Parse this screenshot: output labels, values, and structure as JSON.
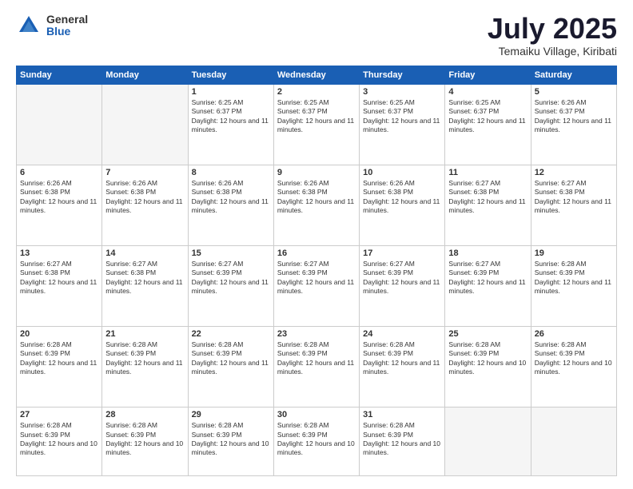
{
  "logo": {
    "general": "General",
    "blue": "Blue"
  },
  "header": {
    "month_year": "July 2025",
    "location": "Temaiku Village, Kiribati"
  },
  "days_of_week": [
    "Sunday",
    "Monday",
    "Tuesday",
    "Wednesday",
    "Thursday",
    "Friday",
    "Saturday"
  ],
  "weeks": [
    [
      {
        "day": "",
        "info": ""
      },
      {
        "day": "",
        "info": ""
      },
      {
        "day": "1",
        "info": "Sunrise: 6:25 AM\nSunset: 6:37 PM\nDaylight: 12 hours and 11 minutes."
      },
      {
        "day": "2",
        "info": "Sunrise: 6:25 AM\nSunset: 6:37 PM\nDaylight: 12 hours and 11 minutes."
      },
      {
        "day": "3",
        "info": "Sunrise: 6:25 AM\nSunset: 6:37 PM\nDaylight: 12 hours and 11 minutes."
      },
      {
        "day": "4",
        "info": "Sunrise: 6:25 AM\nSunset: 6:37 PM\nDaylight: 12 hours and 11 minutes."
      },
      {
        "day": "5",
        "info": "Sunrise: 6:26 AM\nSunset: 6:37 PM\nDaylight: 12 hours and 11 minutes."
      }
    ],
    [
      {
        "day": "6",
        "info": "Sunrise: 6:26 AM\nSunset: 6:38 PM\nDaylight: 12 hours and 11 minutes."
      },
      {
        "day": "7",
        "info": "Sunrise: 6:26 AM\nSunset: 6:38 PM\nDaylight: 12 hours and 11 minutes."
      },
      {
        "day": "8",
        "info": "Sunrise: 6:26 AM\nSunset: 6:38 PM\nDaylight: 12 hours and 11 minutes."
      },
      {
        "day": "9",
        "info": "Sunrise: 6:26 AM\nSunset: 6:38 PM\nDaylight: 12 hours and 11 minutes."
      },
      {
        "day": "10",
        "info": "Sunrise: 6:26 AM\nSunset: 6:38 PM\nDaylight: 12 hours and 11 minutes."
      },
      {
        "day": "11",
        "info": "Sunrise: 6:27 AM\nSunset: 6:38 PM\nDaylight: 12 hours and 11 minutes."
      },
      {
        "day": "12",
        "info": "Sunrise: 6:27 AM\nSunset: 6:38 PM\nDaylight: 12 hours and 11 minutes."
      }
    ],
    [
      {
        "day": "13",
        "info": "Sunrise: 6:27 AM\nSunset: 6:38 PM\nDaylight: 12 hours and 11 minutes."
      },
      {
        "day": "14",
        "info": "Sunrise: 6:27 AM\nSunset: 6:38 PM\nDaylight: 12 hours and 11 minutes."
      },
      {
        "day": "15",
        "info": "Sunrise: 6:27 AM\nSunset: 6:39 PM\nDaylight: 12 hours and 11 minutes."
      },
      {
        "day": "16",
        "info": "Sunrise: 6:27 AM\nSunset: 6:39 PM\nDaylight: 12 hours and 11 minutes."
      },
      {
        "day": "17",
        "info": "Sunrise: 6:27 AM\nSunset: 6:39 PM\nDaylight: 12 hours and 11 minutes."
      },
      {
        "day": "18",
        "info": "Sunrise: 6:27 AM\nSunset: 6:39 PM\nDaylight: 12 hours and 11 minutes."
      },
      {
        "day": "19",
        "info": "Sunrise: 6:28 AM\nSunset: 6:39 PM\nDaylight: 12 hours and 11 minutes."
      }
    ],
    [
      {
        "day": "20",
        "info": "Sunrise: 6:28 AM\nSunset: 6:39 PM\nDaylight: 12 hours and 11 minutes."
      },
      {
        "day": "21",
        "info": "Sunrise: 6:28 AM\nSunset: 6:39 PM\nDaylight: 12 hours and 11 minutes."
      },
      {
        "day": "22",
        "info": "Sunrise: 6:28 AM\nSunset: 6:39 PM\nDaylight: 12 hours and 11 minutes."
      },
      {
        "day": "23",
        "info": "Sunrise: 6:28 AM\nSunset: 6:39 PM\nDaylight: 12 hours and 11 minutes."
      },
      {
        "day": "24",
        "info": "Sunrise: 6:28 AM\nSunset: 6:39 PM\nDaylight: 12 hours and 11 minutes."
      },
      {
        "day": "25",
        "info": "Sunrise: 6:28 AM\nSunset: 6:39 PM\nDaylight: 12 hours and 10 minutes."
      },
      {
        "day": "26",
        "info": "Sunrise: 6:28 AM\nSunset: 6:39 PM\nDaylight: 12 hours and 10 minutes."
      }
    ],
    [
      {
        "day": "27",
        "info": "Sunrise: 6:28 AM\nSunset: 6:39 PM\nDaylight: 12 hours and 10 minutes."
      },
      {
        "day": "28",
        "info": "Sunrise: 6:28 AM\nSunset: 6:39 PM\nDaylight: 12 hours and 10 minutes."
      },
      {
        "day": "29",
        "info": "Sunrise: 6:28 AM\nSunset: 6:39 PM\nDaylight: 12 hours and 10 minutes."
      },
      {
        "day": "30",
        "info": "Sunrise: 6:28 AM\nSunset: 6:39 PM\nDaylight: 12 hours and 10 minutes."
      },
      {
        "day": "31",
        "info": "Sunrise: 6:28 AM\nSunset: 6:39 PM\nDaylight: 12 hours and 10 minutes."
      },
      {
        "day": "",
        "info": ""
      },
      {
        "day": "",
        "info": ""
      }
    ]
  ]
}
